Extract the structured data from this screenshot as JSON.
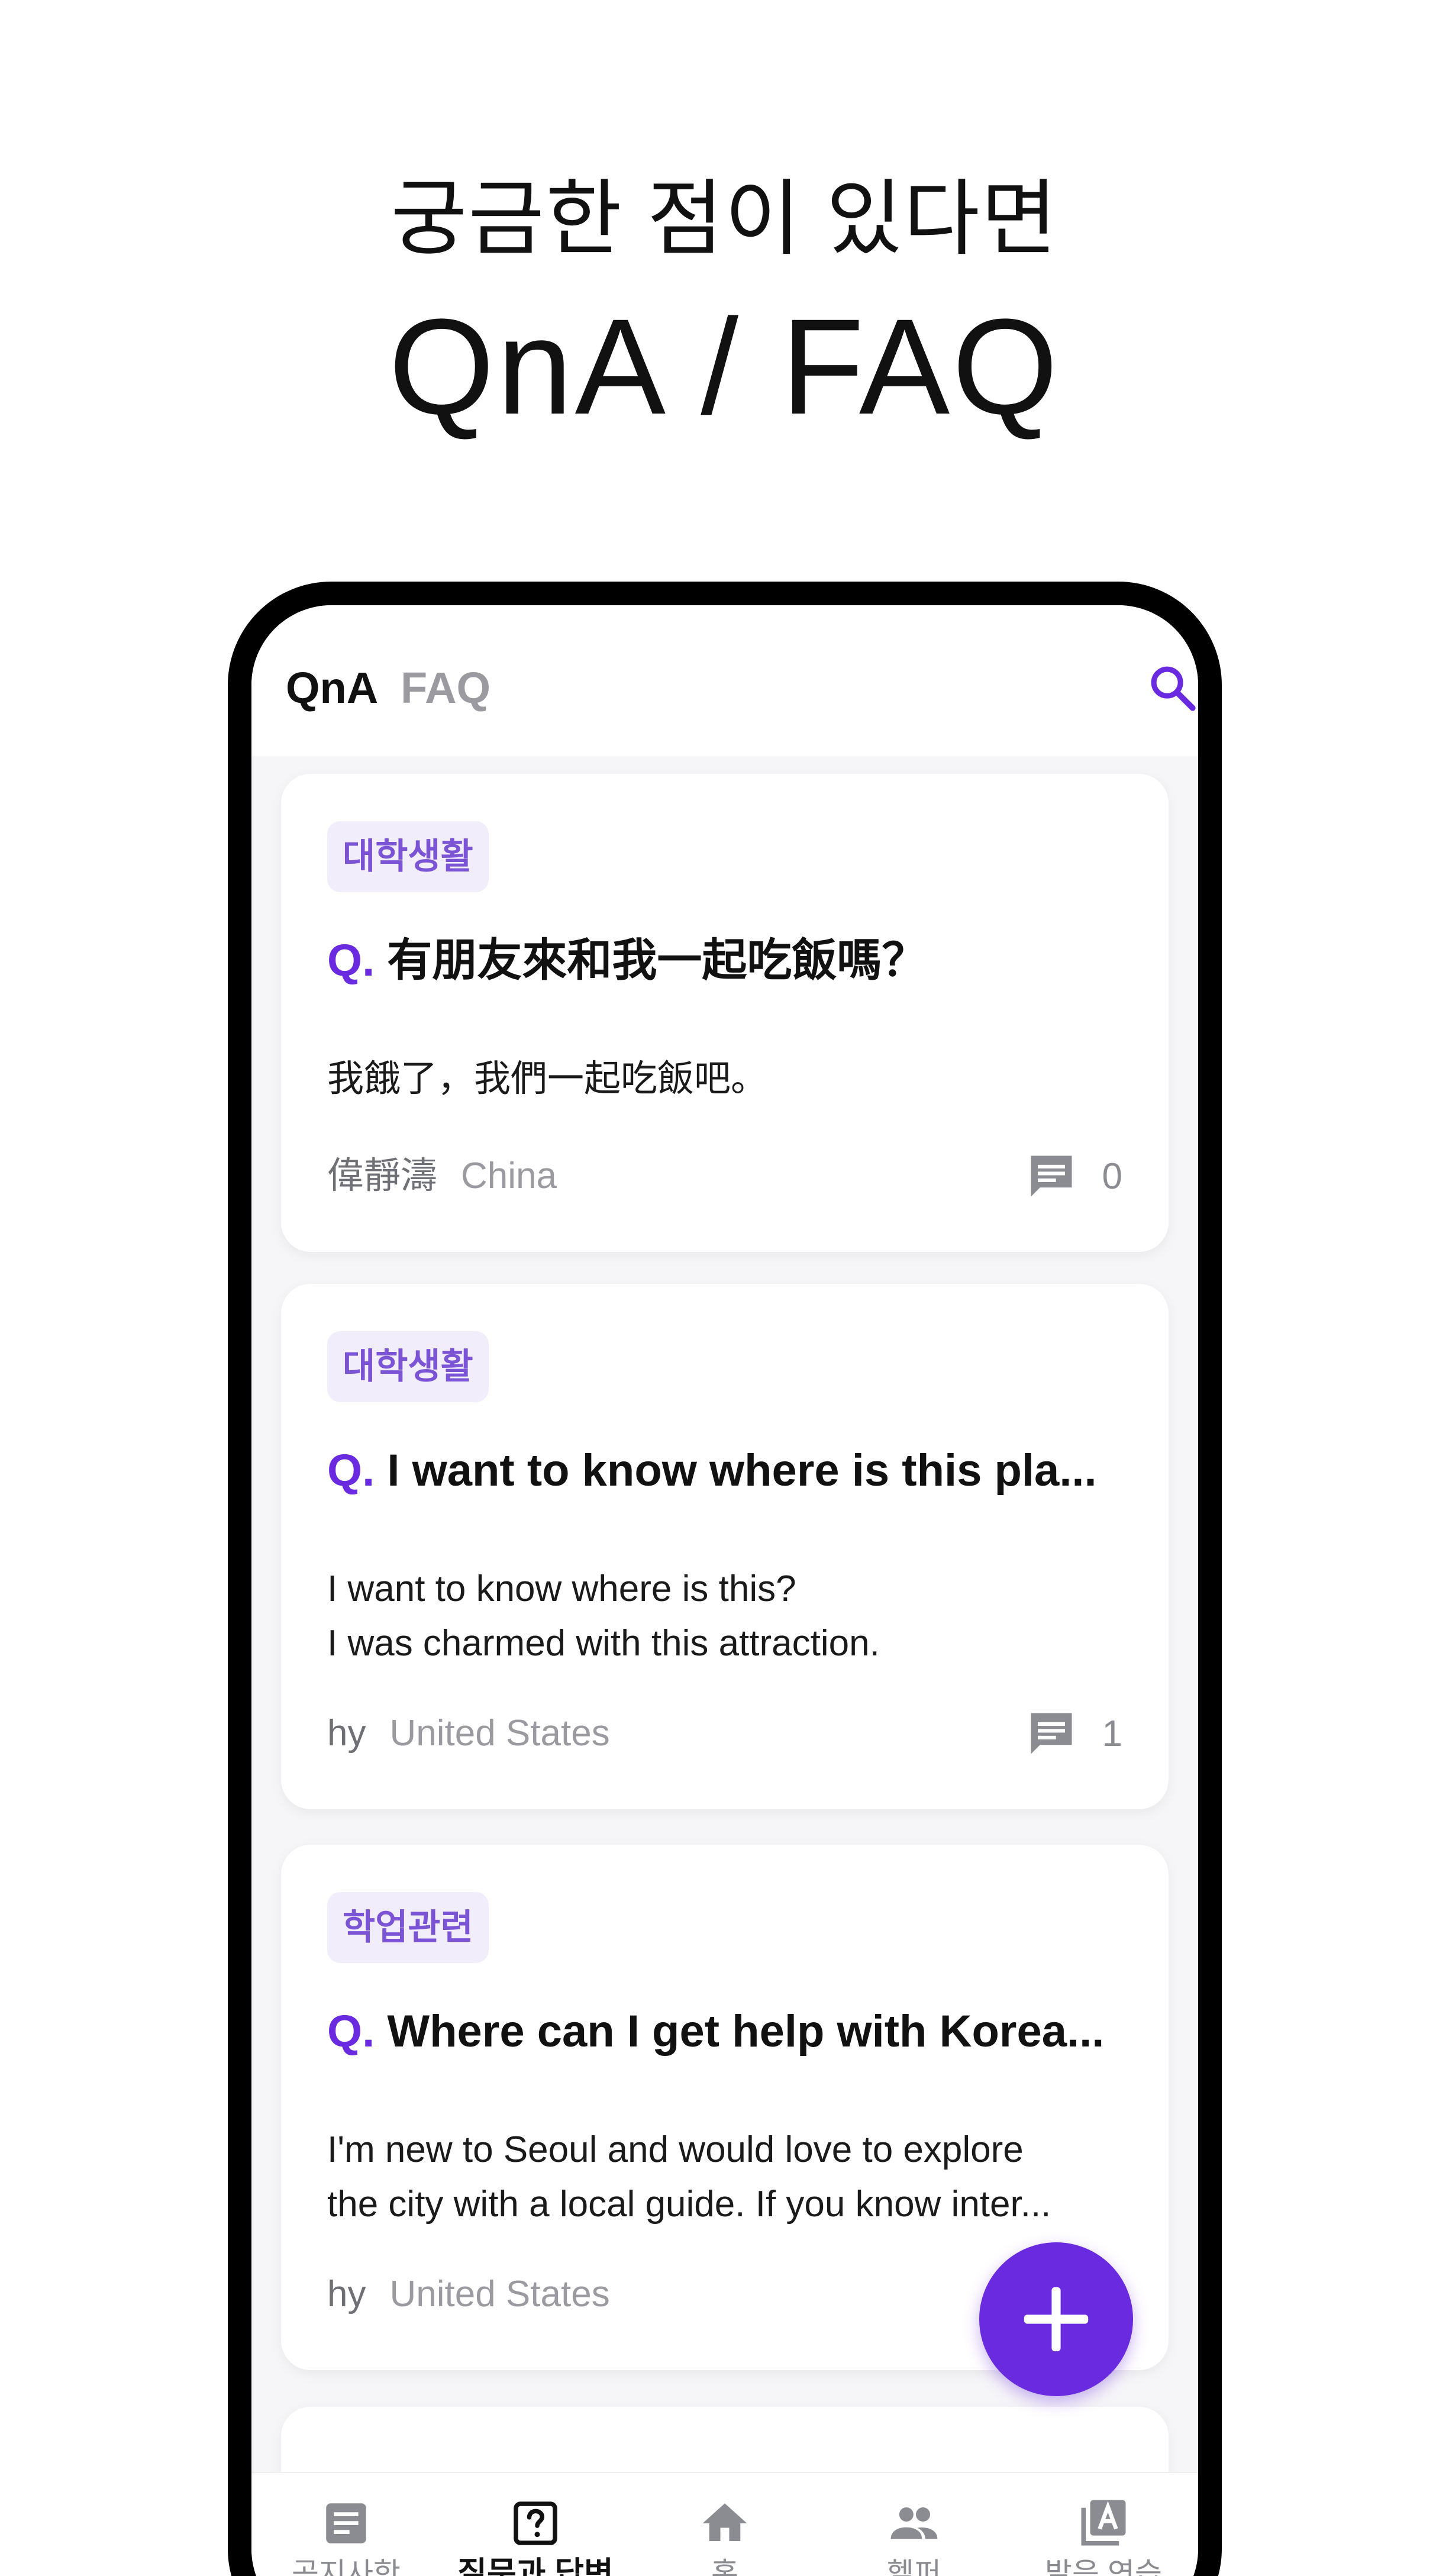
{
  "promo": {
    "subtitle": "궁금한 점이 있다면",
    "title": "QnA / FAQ"
  },
  "header": {
    "tabs": [
      {
        "label": "QnA",
        "active": true
      },
      {
        "label": "FAQ",
        "active": false
      }
    ],
    "search_icon": "search-icon",
    "accent_color": "#6a2be0"
  },
  "posts": [
    {
      "category": "대학생활",
      "q_mark": "Q.",
      "title": "有朋友來和我一起吃飯嗎？",
      "body": [
        "我餓了，我們一起吃飯吧。"
      ],
      "author": "偉靜濤",
      "country": "China",
      "comment_count": "0"
    },
    {
      "category": "대학생활",
      "q_mark": "Q.",
      "title": "I want to know where is this pla...",
      "body": [
        "I want to know where is this?",
        "I was charmed with this attraction."
      ],
      "author": "hy",
      "country": "United States",
      "comment_count": "1"
    },
    {
      "category": "학업관련",
      "q_mark": "Q.",
      "title": "Where can I get help with Korea...",
      "body": [
        "I'm new to Seoul and would love to explore",
        "the city with a local guide. If you know inter..."
      ],
      "author": "hy",
      "country": "United States",
      "comment_count": ""
    }
  ],
  "fab": {
    "icon": "plus-icon"
  },
  "bottom_nav": [
    {
      "label": "공지사항",
      "icon": "notice-icon",
      "active": false
    },
    {
      "label": "질문과 답변",
      "icon": "question-box-icon",
      "active": true
    },
    {
      "label": "홈",
      "icon": "home-icon",
      "active": false
    },
    {
      "label": "헬퍼",
      "icon": "people-icon",
      "active": false
    },
    {
      "label": "발음 연습",
      "icon": "pronunciation-icon",
      "active": false
    }
  ]
}
